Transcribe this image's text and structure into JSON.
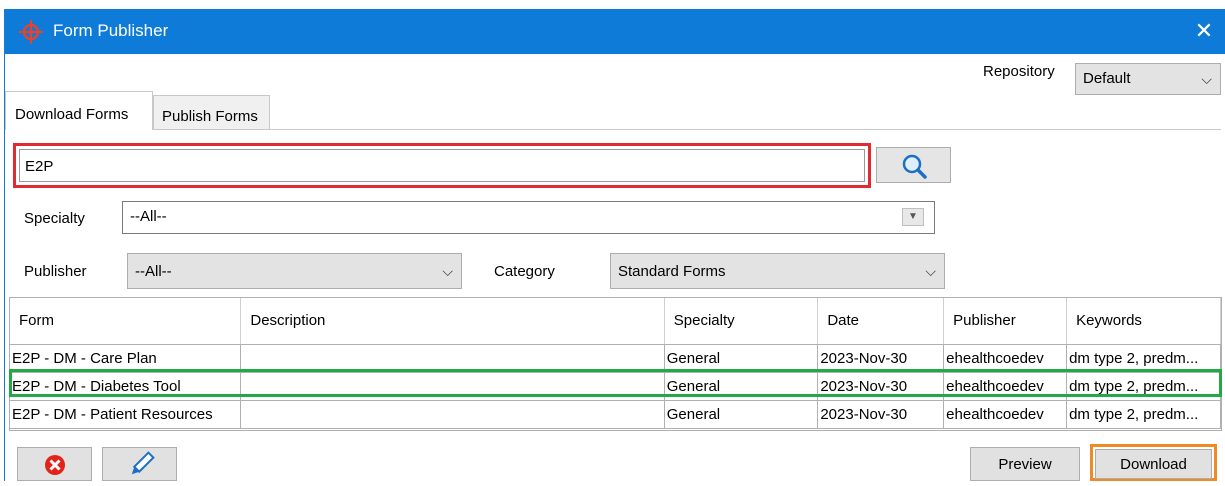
{
  "window": {
    "title": "Form Publisher",
    "close_glyph": "✕"
  },
  "repository": {
    "label": "Repository",
    "value": "Default"
  },
  "tabs": [
    {
      "label": "Download Forms",
      "active": true
    },
    {
      "label": "Publish Forms",
      "active": false
    }
  ],
  "search": {
    "value": "E2P",
    "button_icon": "search-icon"
  },
  "filters": {
    "specialty_label": "Specialty",
    "specialty_value": "--All--",
    "publisher_label": "Publisher",
    "publisher_value": "--All--",
    "category_label": "Category",
    "category_value": "Standard Forms"
  },
  "table": {
    "columns": [
      "Form",
      "Description",
      "Specialty",
      "Date",
      "Publisher",
      "Keywords"
    ],
    "rows": [
      [
        "E2P - DM - Care Plan",
        "",
        "General",
        "2023-Nov-30",
        "ehealthcoedev",
        "dm type 2, predm..."
      ],
      [
        "E2P - DM - Diabetes Tool",
        "",
        "General",
        "2023-Nov-30",
        "ehealthcoedev",
        "dm type 2, predm..."
      ],
      [
        "E2P - DM - Patient Resources",
        "",
        "General",
        "2023-Nov-30",
        "ehealthcoedev",
        "dm type 2, predm..."
      ]
    ]
  },
  "buttons": {
    "delete_icon": "delete-icon",
    "edit_icon": "pencil-icon",
    "preview": "Preview",
    "download": "Download"
  },
  "colors": {
    "titlebar": "#0f7bd8",
    "search_highlight": "#e02b35",
    "row_highlight": "#22a845",
    "download_highlight": "#f08a24"
  }
}
